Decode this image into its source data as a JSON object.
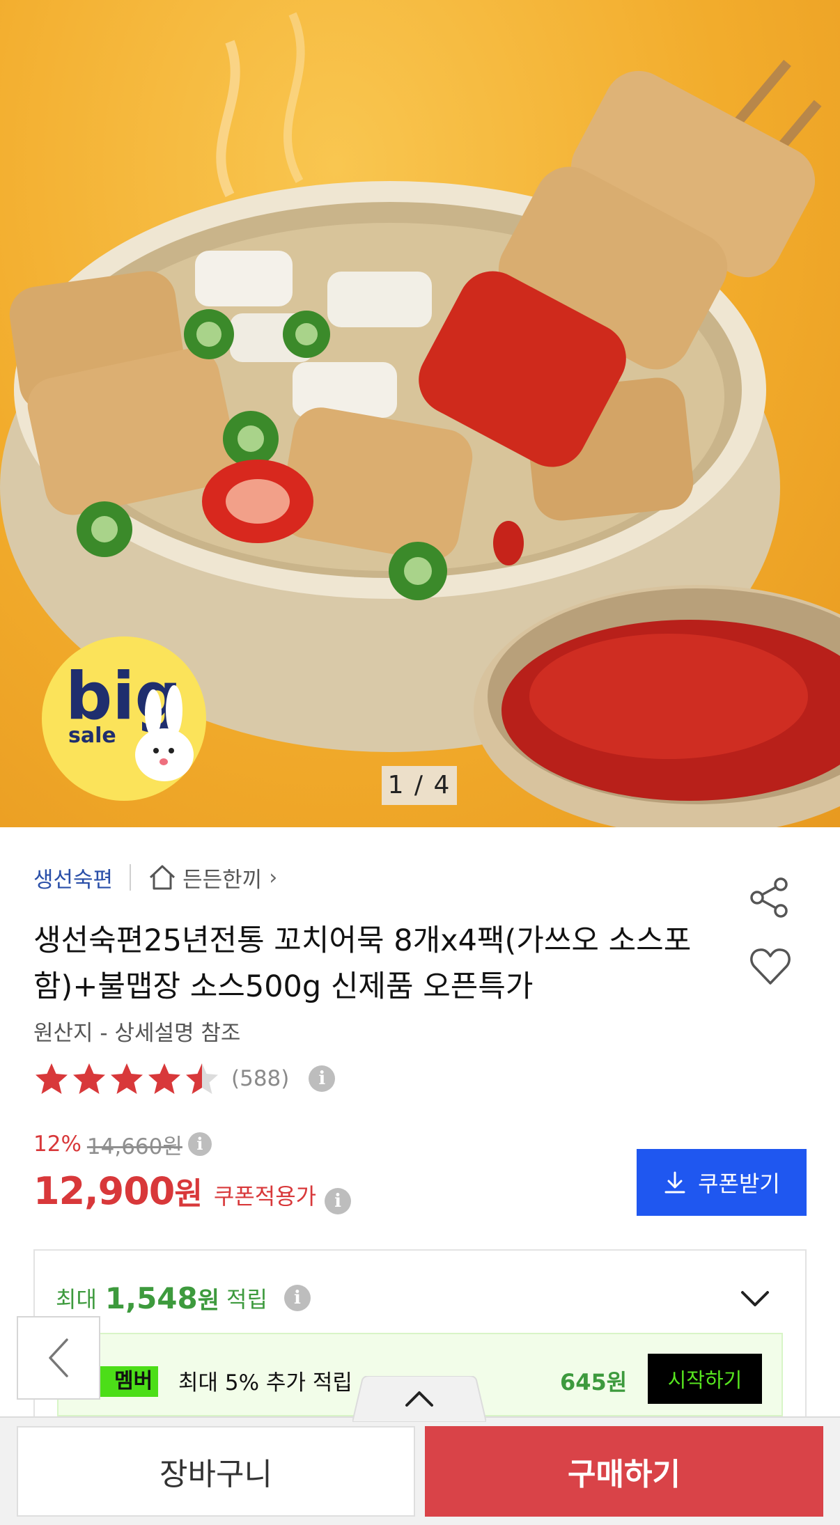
{
  "gallery": {
    "counter": "1 / 4",
    "sale_badge_big": "big",
    "sale_badge_small": "sale"
  },
  "brand": {
    "name": "생선숙편",
    "store": "든든한끼",
    "store_chevron": "›"
  },
  "product": {
    "title": "생선숙편25년전통 꼬치어묵 8개x4팩(가쓰오 소스포함)+불맵장 소스500g 신제품 오픈특가",
    "origin": "원산지 - 상세설명 참조",
    "rating_stars": 4.5,
    "rating_count": "(588)"
  },
  "price": {
    "discount_pct": "12%",
    "original": "14,660원",
    "final_amount": "12,900",
    "final_unit": "원",
    "coupon_label": "쿠폰적용가",
    "info_glyph": "i"
  },
  "coupon_button": {
    "label": "쿠폰받기"
  },
  "points": {
    "prefix": "최대",
    "amount": "1,548",
    "unit": "원",
    "suffix": "적립"
  },
  "membership": {
    "badge": "멤버",
    "text": "최대 5% 추가 적립",
    "amount": "645원",
    "start_label": "시작하기"
  },
  "bottom_bar": {
    "cart_label": "장바구니",
    "buy_label": "구매하기"
  },
  "colors": {
    "accent_red": "#d8383a",
    "coupon_blue": "#1f57f0",
    "points_green": "#3d9a3d",
    "buy_red": "#d94348"
  },
  "icons": {
    "store": "home-icon",
    "share": "share-icon",
    "like": "heart-icon",
    "info": "info-icon",
    "download": "download-icon",
    "expand": "chevron-down-icon",
    "back": "chevron-left-icon",
    "pull": "chevron-up-icon"
  }
}
